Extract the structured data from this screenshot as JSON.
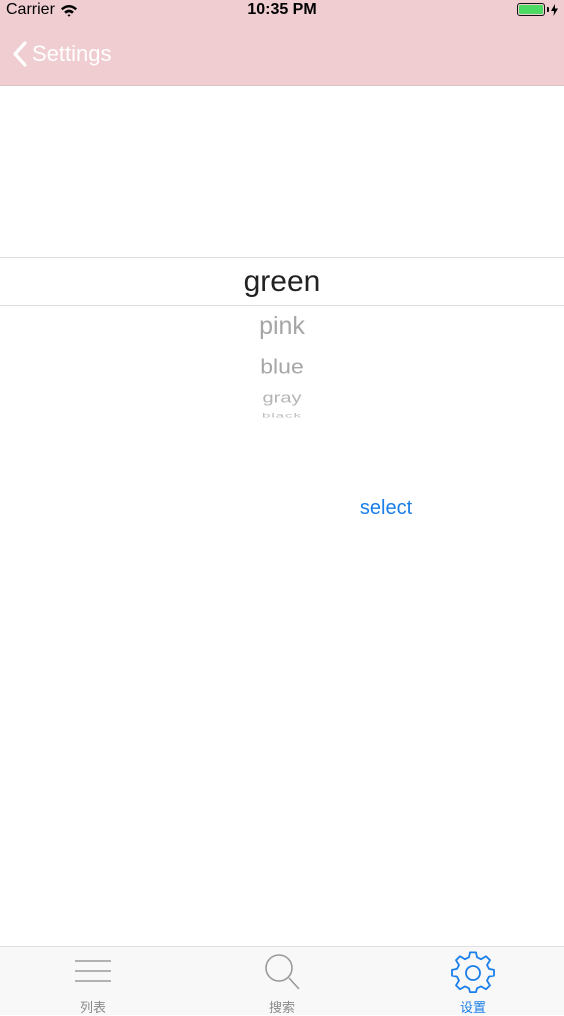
{
  "status_bar": {
    "carrier": "Carrier",
    "time": "10:35 PM"
  },
  "nav": {
    "back_label": "Settings"
  },
  "picker": {
    "selected": "green",
    "items": [
      "pink",
      "blue",
      "gray",
      "black"
    ]
  },
  "select_button": {
    "label": "select"
  },
  "tabbar": {
    "tabs": [
      {
        "label": "列表",
        "icon": "list-icon",
        "active": false
      },
      {
        "label": "搜索",
        "icon": "search-icon",
        "active": false
      },
      {
        "label": "设置",
        "icon": "gear-icon",
        "active": true
      }
    ]
  },
  "colors": {
    "nav_bg": "#efcdd1",
    "accent": "#1a7ee8",
    "battery": "#4cd964"
  }
}
